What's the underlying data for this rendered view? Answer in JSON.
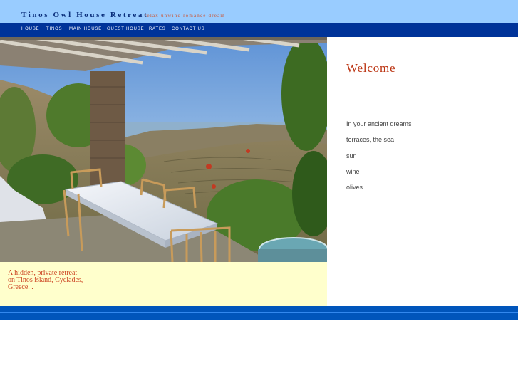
{
  "header": {
    "site_title": "Tinos Owl House Retreat",
    "tagline": "relax unwind romance dream",
    "background_color": "#99ccff"
  },
  "nav": {
    "items": [
      {
        "label": "HOUSE"
      },
      {
        "label": "TINOS"
      },
      {
        "label": "MAIN HOUSE"
      },
      {
        "label": "GUEST HOUSE"
      },
      {
        "label": "RATES"
      },
      {
        "label": "CONTACT US"
      }
    ],
    "background_color": "#003399"
  },
  "caption": {
    "lines": [
      "A hidden, private retreat",
      "on Tinos island, Cyclades,",
      "Greece. ."
    ],
    "background_color": "#ffffcc"
  },
  "welcome": {
    "title": "Welcome",
    "lines": [
      "In your ancient dreams",
      "terraces, the sea",
      "sun",
      "wine",
      "olives"
    ]
  },
  "footer": {
    "background_color": "#0055bb"
  }
}
